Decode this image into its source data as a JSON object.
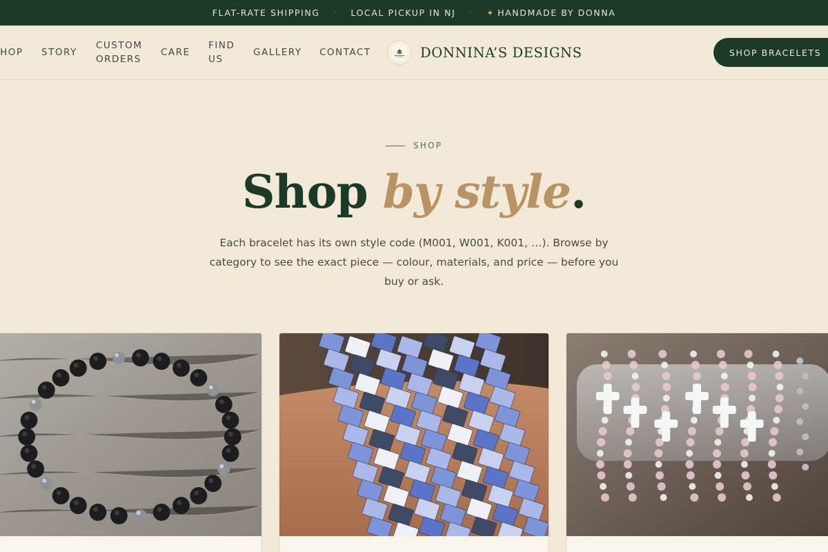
{
  "announcement": {
    "items": [
      "FLAT-RATE SHIPPING",
      "LOCAL PICKUP IN NJ",
      "HANDMADE BY DONNA"
    ],
    "separator": "·",
    "star": "✦"
  },
  "nav": {
    "items": [
      {
        "label": "SHOP"
      },
      {
        "label": "STORY"
      },
      {
        "label": "CUSTOM\nORDERS"
      },
      {
        "label": "CARE"
      },
      {
        "label": "FIND\nUS"
      },
      {
        "label": "GALLERY"
      },
      {
        "label": "CONTACT"
      }
    ]
  },
  "brand": {
    "name": "DONNINA’S DESIGNS",
    "logo_icon": "donninas-designs-logo"
  },
  "cta": {
    "label": "SHOP BRACELETS"
  },
  "hero": {
    "eyebrow": "SHOP",
    "title_main": "Shop ",
    "title_accent": "by style",
    "title_end": ".",
    "lede": "Each bracelet has its own style code (M001, W001, K001, …). Browse by category to see the exact piece — colour, materials, and price — before you buy or ask."
  },
  "cards": [
    {
      "image": "black-onyx-hematite-bead-bracelet"
    },
    {
      "image": "blue-white-tile-bead-bracelet-stack"
    },
    {
      "image": "pink-cross-bead-bracelets-on-stand"
    }
  ],
  "colors": {
    "background": "#f2e9d8",
    "topbar": "#1b3a28",
    "accent_gold": "#b89463",
    "brand_green": "#1b3a28"
  }
}
